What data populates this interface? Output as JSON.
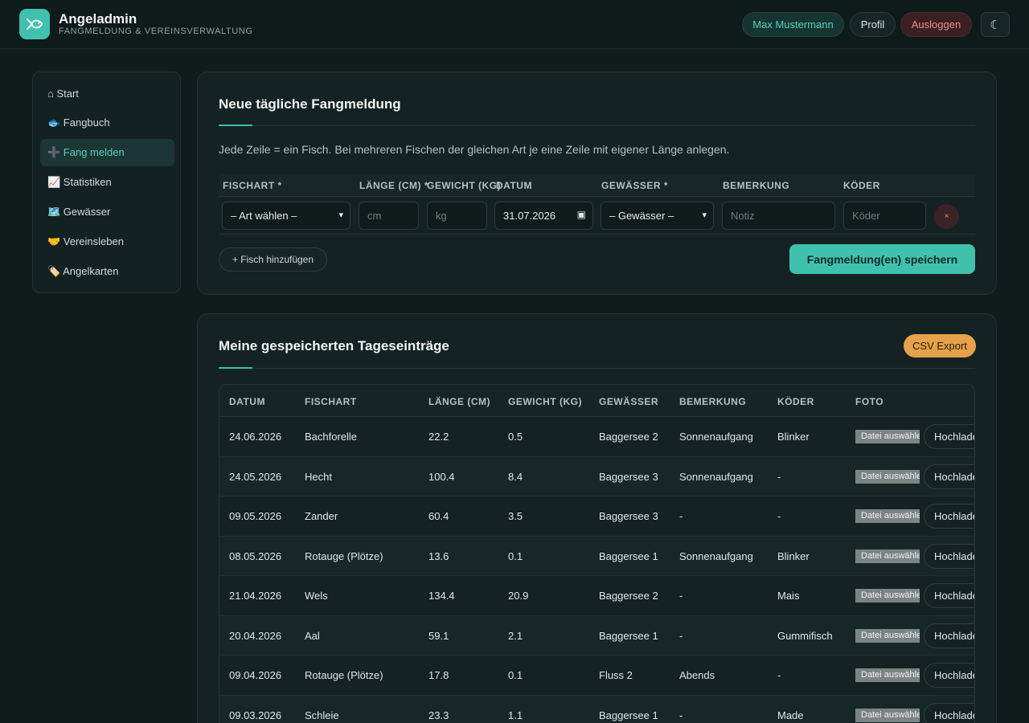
{
  "header": {
    "app_title": "Angeladmin",
    "app_subtitle": "Fangmeldung & Vereinsverwaltung",
    "user_name": "Max Mustermann",
    "profile_label": "Profil",
    "logout_label": "Ausloggen",
    "theme_toggle": "☾"
  },
  "sidebar": {
    "items": [
      {
        "label": "⌂ Start"
      },
      {
        "label": "🐟 Fangbuch"
      },
      {
        "label": "➕ Fang melden"
      },
      {
        "label": "📈 Statistiken"
      },
      {
        "label": "🗺️ Gewässer"
      },
      {
        "label": "🤝 Vereinsleben"
      },
      {
        "label": "🏷️ Angelkarten"
      }
    ],
    "active_index": 2
  },
  "form": {
    "title": "Neue tägliche Fangmeldung",
    "hint": "Jede Zeile = ein Fisch. Bei mehreren Fischen der gleichen Art je eine Zeile mit eigener Länge anlegen.",
    "columns": [
      "FISCHART *",
      "LÄNGE (CM) *",
      "GEWICHT (KG)",
      "DATUM",
      "GEWÄSSER *",
      "BEMERKUNG",
      "KÖDER"
    ],
    "row": {
      "species_select": "– Art wählen –",
      "length_placeholder": "cm",
      "weight_placeholder": "kg",
      "date_value": "31.07.2026",
      "water_select": "– Gewässer –",
      "note_placeholder": "Notiz",
      "bait_placeholder": "Köder",
      "delete_label": "×"
    },
    "add_fish_label": "+ Fisch hinzufügen",
    "save_label": "Fangmeldung(en) speichern"
  },
  "entries": {
    "title": "Meine gespeicherten Tageseinträge",
    "csv_label": "CSV Export",
    "columns": [
      "DATUM",
      "FISCHART",
      "LÄNGE (CM)",
      "GEWICHT (KG)",
      "GEWÄSSER",
      "BEMERKUNG",
      "KÖDER",
      "FOTO"
    ],
    "file_label": "Datei auswählen",
    "upload_label": "Hochladen",
    "rows": [
      {
        "date": "24.06.2026",
        "species": "Bachforelle",
        "length": "22.2",
        "weight": "0.5",
        "water": "Baggersee 2",
        "note": "Sonnenaufgang",
        "bait": "Blinker"
      },
      {
        "date": "24.05.2026",
        "species": "Hecht",
        "length": "100.4",
        "weight": "8.4",
        "water": "Baggersee 3",
        "note": "Sonnenaufgang",
        "bait": "-"
      },
      {
        "date": "09.05.2026",
        "species": "Zander",
        "length": "60.4",
        "weight": "3.5",
        "water": "Baggersee 3",
        "note": "-",
        "bait": "-"
      },
      {
        "date": "08.05.2026",
        "species": "Rotauge (Plötze)",
        "length": "13.6",
        "weight": "0.1",
        "water": "Baggersee 1",
        "note": "Sonnenaufgang",
        "bait": "Blinker"
      },
      {
        "date": "21.04.2026",
        "species": "Wels",
        "length": "134.4",
        "weight": "20.9",
        "water": "Baggersee 2",
        "note": "-",
        "bait": "Mais"
      },
      {
        "date": "20.04.2026",
        "species": "Aal",
        "length": "59.1",
        "weight": "2.1",
        "water": "Baggersee 1",
        "note": "-",
        "bait": "Gummifisch"
      },
      {
        "date": "09.04.2026",
        "species": "Rotauge (Plötze)",
        "length": "17.8",
        "weight": "0.1",
        "water": "Fluss 2",
        "note": "Abends",
        "bait": "-"
      },
      {
        "date": "09.03.2026",
        "species": "Schleie",
        "length": "23.3",
        "weight": "1.1",
        "water": "Baggersee 1",
        "note": "-",
        "bait": "Made"
      }
    ]
  }
}
